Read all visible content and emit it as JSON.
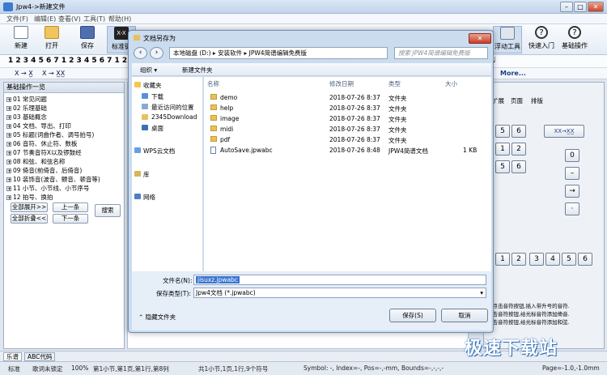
{
  "app": {
    "title": "Jpw4->新建文件"
  },
  "menu": [
    "文件(F)",
    "编辑(E)",
    "查看(V)",
    "工具(T)",
    "帮助(H)"
  ],
  "toolbar": {
    "new_label": "新建",
    "open_label": "打开",
    "save_label": "保存",
    "std_label": "标准键",
    "float_label": "浮动工具",
    "quick_label": "快速入门",
    "basic_label": "基础操作"
  },
  "numrow": "1 2 3 4 5 6 7 1 2 3 4 5 6 7 1 2 3 4 5 6 7",
  "row2": [
    "X → X̲",
    "X → X̲X̲",
    "More..."
  ],
  "left_panel": {
    "title": "基础操作一览",
    "topics": [
      "01 常见问题",
      "02 乐理基础",
      "03 基础概念",
      "04 文档、导出、打印",
      "05 标题(词曲作者、调号拍号)",
      "06 音符、休止符、数板",
      "07 节奏音符X以及锣鼓经",
      "08 和弦、和弦名称",
      "09 倚音(前倚音、后倚音)",
      "10 装饰音(波音、颤音、顿音等)",
      "11 小节、小节线、小节序号",
      "12 拍号、换拍"
    ],
    "expand_all": "全部展开>>",
    "collapse_all": "全部折叠<<",
    "prev": "上一条",
    "next": "下一条",
    "search": "搜索"
  },
  "right_panel": {
    "tabs": [
      "扩展",
      "页面",
      "排版"
    ],
    "hint_lines": [
      "内点击音符按钮,插入带升号的音符.",
      "点击音符按钮,给光标音符添加倚音.",
      "点击音符按钮,给光标音符添加和弦."
    ]
  },
  "tabs": [
    "乐谱",
    "ABC代码"
  ],
  "status": {
    "mode": "标准",
    "lock": "歌词未锁定",
    "zoom": "100%",
    "pos": "第1小节,第1页,第1行,第8列",
    "count": "共1小节,1页,1行,9个符号",
    "symbol": "Symbol: -, Index=-, Pos=-,-mm, Bounds=-,-,-,-",
    "page": "Page=-1.0,-1.0mm"
  },
  "dialog": {
    "title": "文档另存为",
    "address": [
      "本地磁盘 (D:)",
      "安装软件",
      "JPW4简谱编辑免费版"
    ],
    "search_placeholder": "搜索 JPW4简谱编辑免费版",
    "organize": "组织 ▾",
    "new_folder": "新建文件夹",
    "nav": {
      "favorites": "收藏夹",
      "downloads": "下载",
      "recent": "最近访问的位置",
      "download2345": "2345Download",
      "desktop": "桌面",
      "wps": "WPS云文档",
      "library": "库",
      "network": "网络"
    },
    "columns": {
      "name": "名称",
      "date": "修改日期",
      "type": "类型",
      "size": "大小"
    },
    "files": [
      {
        "name": "demo",
        "date": "2018-07-26 8:37",
        "type": "文件夹",
        "size": ""
      },
      {
        "name": "help",
        "date": "2018-07-26 8:37",
        "type": "文件夹",
        "size": ""
      },
      {
        "name": "image",
        "date": "2018-07-26 8:37",
        "type": "文件夹",
        "size": ""
      },
      {
        "name": "midi",
        "date": "2018-07-26 8:37",
        "type": "文件夹",
        "size": ""
      },
      {
        "name": "pdf",
        "date": "2018-07-26 8:37",
        "type": "文件夹",
        "size": ""
      },
      {
        "name": "AutoSave.jpwabc",
        "date": "2018-07-26 8:48",
        "type": "JPW4简谱文档",
        "size": "1 KB"
      }
    ],
    "filename_label": "文件名(N):",
    "filename_value": "jisuxz.jpwabc",
    "filetype_label": "保存类型(T):",
    "filetype_value": "Jpw4文档 (*.jpwabc)",
    "hide_folders": "隐藏文件夹",
    "save_label": "保存(S)",
    "cancel_label": "取消"
  },
  "watermark": "极速下载站"
}
